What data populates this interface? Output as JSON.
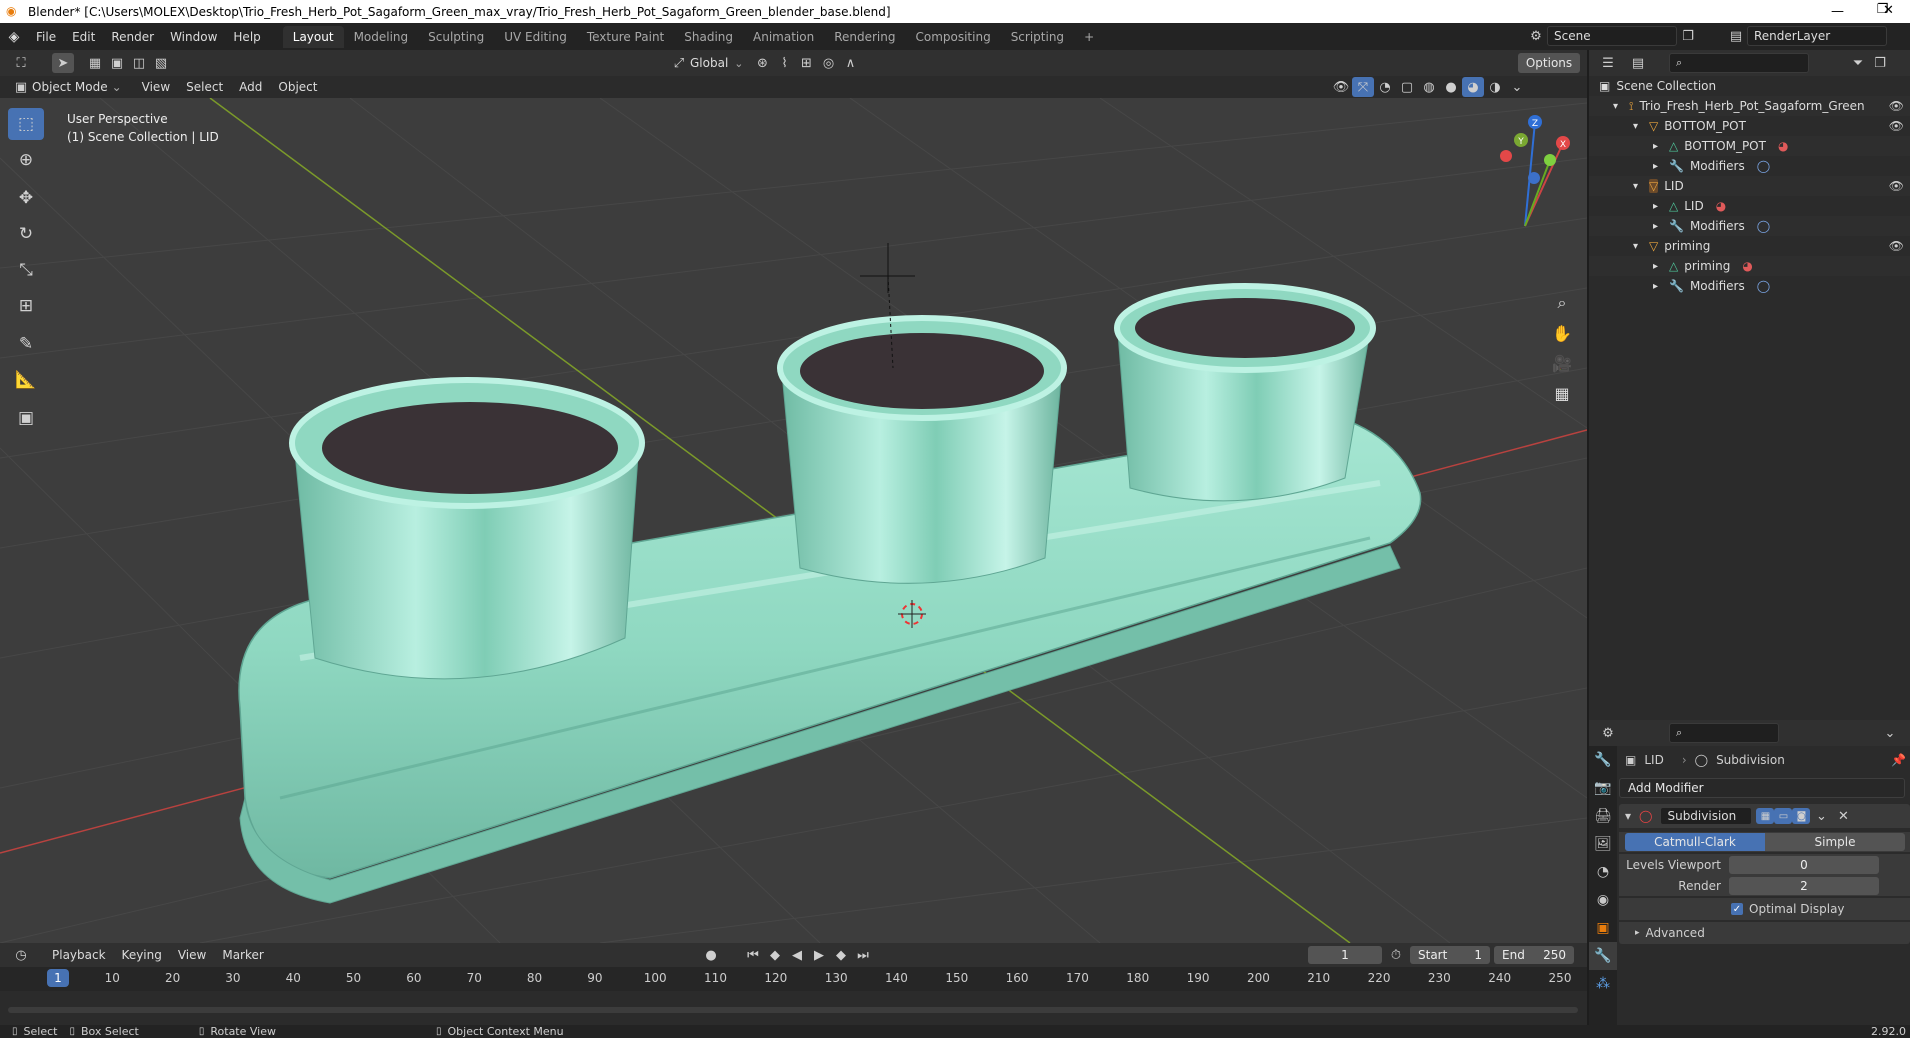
{
  "window": {
    "title": "Blender* [C:\\Users\\MOLEX\\Desktop\\Trio_Fresh_Herb_Pot_Sagaform_Green_max_vray/Trio_Fresh_Herb_Pot_Sagaform_Green_blender_base.blend]",
    "minimize": "—",
    "restore": "❐",
    "close": "✕"
  },
  "menu": {
    "items": [
      "File",
      "Edit",
      "Render",
      "Window",
      "Help"
    ],
    "workspaces": [
      "Layout",
      "Modeling",
      "Sculpting",
      "UV Editing",
      "Texture Paint",
      "Shading",
      "Animation",
      "Rendering",
      "Compositing",
      "Scripting"
    ],
    "active_workspace": "Layout",
    "add_tab": "+",
    "scene": "Scene",
    "render_layer": "RenderLayer"
  },
  "viewport_header": {
    "orientation": "Global",
    "options": "Options",
    "mode": "Object Mode",
    "menus": [
      "View",
      "Select",
      "Add",
      "Object"
    ]
  },
  "viewport": {
    "perspective": "User Perspective",
    "collection_info": "(1) Scene Collection | LID",
    "gizmo": {
      "x": "X",
      "y": "Y",
      "z": "Z"
    },
    "colors": {
      "background": "#3d3d3d",
      "mesh": "#8cd6bd",
      "soil": "#3a3236",
      "x_axis": "#b8423f",
      "y_axis": "#7b9a2a"
    }
  },
  "timeline": {
    "menus": [
      "Playback",
      "Keying",
      "View",
      "Marker"
    ],
    "current_frame": "1",
    "start_label": "Start",
    "start": "1",
    "end_label": "End",
    "end": "250",
    "ticks": [
      "1",
      "10",
      "20",
      "30",
      "40",
      "50",
      "60",
      "70",
      "80",
      "90",
      "100",
      "110",
      "120",
      "130",
      "140",
      "150",
      "160",
      "170",
      "180",
      "190",
      "200",
      "210",
      "220",
      "230",
      "240",
      "250"
    ]
  },
  "statusbar": {
    "select": "Select",
    "box_select": "Box Select",
    "rotate_view": "Rotate View",
    "context_menu": "Object Context Menu",
    "version": "2.92.0"
  },
  "outliner": {
    "rows": [
      {
        "label": "Scene Collection",
        "indent": 0,
        "icon": "collection-icon",
        "eye": false
      },
      {
        "label": "Trio_Fresh_Herb_Pot_Sagaform_Green",
        "indent": 1,
        "icon": "armature-icon",
        "eye": true
      },
      {
        "label": "BOTTOM_POT",
        "indent": 2,
        "icon": "object-icon",
        "eye": true
      },
      {
        "label": "BOTTOM_POT",
        "indent": 3,
        "icon": "mesh-icon",
        "eye": false,
        "material": true
      },
      {
        "label": "Modifiers",
        "indent": 3,
        "icon": "wrench-icon",
        "eye": false,
        "modifier": true
      },
      {
        "label": "LID",
        "indent": 2,
        "icon": "object-icon",
        "eye": true,
        "selected": true
      },
      {
        "label": "LID",
        "indent": 3,
        "icon": "mesh-icon",
        "eye": false,
        "material": true
      },
      {
        "label": "Modifiers",
        "indent": 3,
        "icon": "wrench-icon",
        "eye": false,
        "modifier": true
      },
      {
        "label": "priming",
        "indent": 2,
        "icon": "object-icon",
        "eye": true
      },
      {
        "label": "priming",
        "indent": 3,
        "icon": "mesh-icon",
        "eye": false,
        "material": true
      },
      {
        "label": "Modifiers",
        "indent": 3,
        "icon": "wrench-icon",
        "eye": false,
        "modifier": true
      }
    ]
  },
  "properties": {
    "object": "LID",
    "modifier_name": "Subdivision",
    "add_modifier": "Add Modifier",
    "panel_name": "Subdivision",
    "method_a": "Catmull-Clark",
    "method_b": "Simple",
    "levels_viewport_label": "Levels Viewport",
    "levels_viewport": "0",
    "render_label": "Render",
    "render": "2",
    "optimal_display": "Optimal Display",
    "advanced": "Advanced"
  }
}
